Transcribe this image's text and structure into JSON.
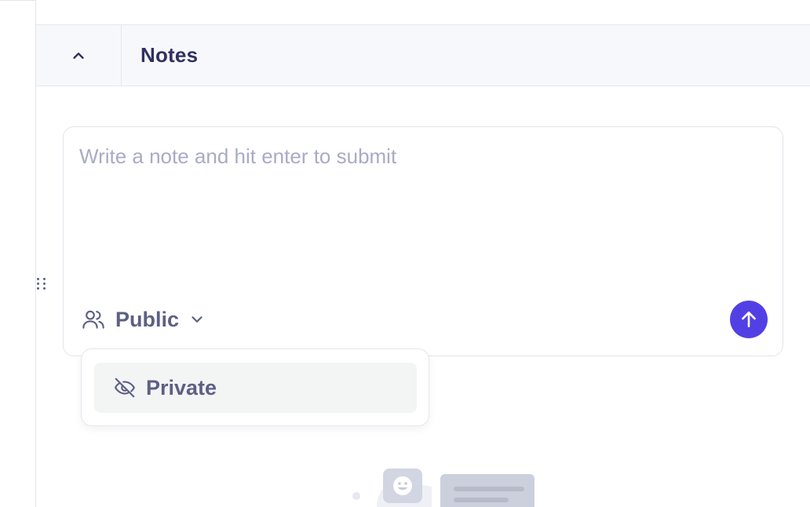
{
  "section": {
    "title": "Notes",
    "collapse_icon": "chevron-up-icon"
  },
  "note_input": {
    "value": "",
    "placeholder": "Write a note and hit enter to submit"
  },
  "visibility": {
    "selected": "Public",
    "selected_icon": "users-icon",
    "toggle_icon": "chevron-down-icon",
    "options": [
      {
        "label": "Private",
        "icon": "eye-off-icon"
      }
    ]
  },
  "submit": {
    "icon": "arrow-up-icon",
    "color": "#5340e5"
  },
  "colors": {
    "accent": "#5340e5",
    "title": "#2f3160",
    "muted": "#5d6084",
    "placeholder": "#a9abc6"
  },
  "empty_state": {
    "illustration": "empty-notes-illustration"
  }
}
